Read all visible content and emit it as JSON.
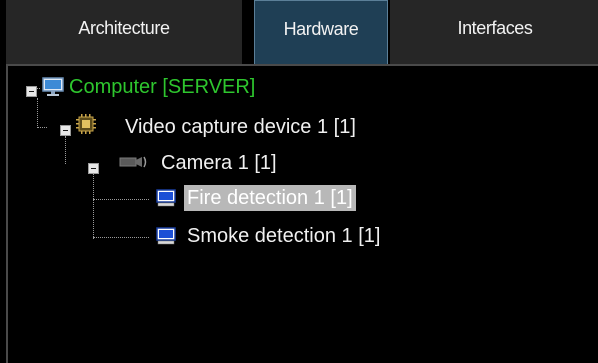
{
  "tabs": [
    {
      "label": "Architecture",
      "active": false
    },
    {
      "label": "Hardware",
      "active": true
    },
    {
      "label": "Interfaces",
      "active": false
    }
  ],
  "tree": {
    "computer": {
      "label": "Computer [SERVER]",
      "icon": "monitor-icon",
      "color": "#2ec62e",
      "expanded": true
    },
    "video_capture": {
      "label": "Video capture device 1 [1]",
      "icon": "capture-board-icon",
      "expanded": true
    },
    "camera": {
      "label": "Camera 1 [1]",
      "icon": "camera-icon",
      "expanded": true
    },
    "fire_detection": {
      "label": "Fire detection 1 [1]",
      "icon": "detector-icon",
      "selected": true
    },
    "smoke_detection": {
      "label": "Smoke detection 1 [1]",
      "icon": "detector-icon",
      "selected": false
    }
  },
  "colors": {
    "background": "#000000",
    "active_tab": "#1f3f55",
    "selection": "#b8b8b8",
    "server_text": "#2ec62e"
  }
}
